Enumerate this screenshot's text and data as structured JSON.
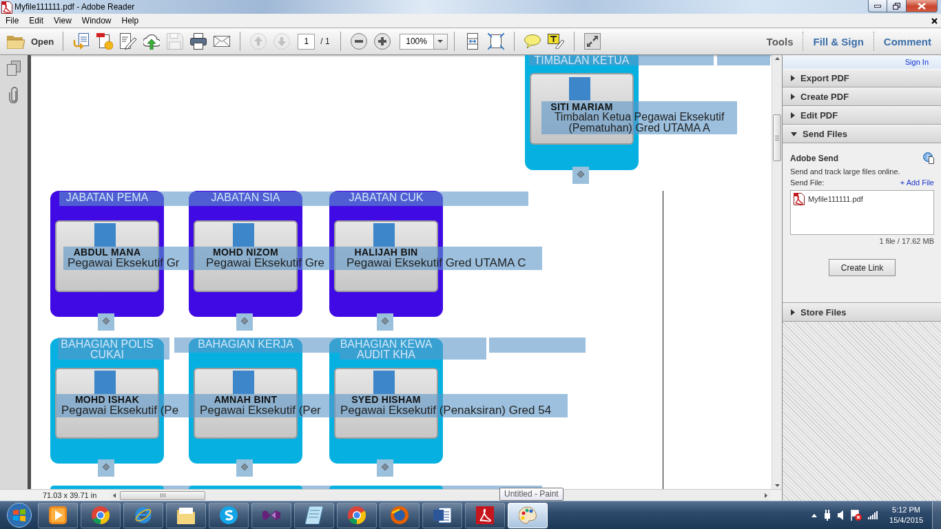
{
  "window": {
    "title": "Myfile111111.pdf - Adobe Reader"
  },
  "menu": [
    "File",
    "Edit",
    "View",
    "Window",
    "Help"
  ],
  "toolbar": {
    "open": "Open",
    "tools": [
      {
        "kind": "convert",
        "disabled": false
      },
      {
        "kind": "combine",
        "disabled": false
      },
      {
        "kind": "edit",
        "disabled": false
      },
      {
        "kind": "upload",
        "disabled": false
      },
      {
        "kind": "save",
        "disabled": true
      },
      {
        "kind": "print",
        "disabled": false
      },
      {
        "kind": "email",
        "disabled": false
      }
    ],
    "page_nav": [
      {
        "kind": "prev",
        "disabled": true
      },
      {
        "kind": "next",
        "disabled": true
      }
    ],
    "page_field": {
      "value": "1"
    },
    "page_total": "/ 1",
    "zoom_field": {
      "value": "100%"
    },
    "tasks": [
      {
        "label": "Tools",
        "selected": true
      },
      {
        "label": "Fill & Sign",
        "selected": false
      },
      {
        "label": "Comment",
        "selected": false
      }
    ]
  },
  "org_chart": {
    "text_selected": true,
    "levels": [
      [
        {
          "color": "#06b1e1",
          "header": [
            "TIMBALAN KETUA"
          ],
          "name": "SITI MARIAM",
          "title": [
            "Timbalan Ketua Pegawai Eksekutif",
            "(Pematuhan) Gred UTAMA A"
          ]
        }
      ],
      [
        {
          "color": "#400ae4",
          "header": [
            "JABATAN PEMA"
          ],
          "name": "ABDUL MANA",
          "title": [
            "Pegawai Eksekutif Gr"
          ]
        },
        {
          "color": "#400ae4",
          "header": [
            "JABATAN SIA"
          ],
          "name": "MOHD NIZOM",
          "title": [
            "Pegawai Eksekutif Gre"
          ]
        },
        {
          "color": "#400ae4",
          "header": [
            "JABATAN CUK"
          ],
          "name": "HALIJAH BIN",
          "title": [
            "Pegawai Eksekutif Gred UTAMA C"
          ]
        }
      ],
      [
        {
          "color": "#06b1e1",
          "header": [
            "BAHAGIAN POLIS",
            "CUKAI"
          ],
          "name": "MOHD ISHAK",
          "title": [
            "Pegawai Eksekutif (Pe"
          ]
        },
        {
          "color": "#06b1e1",
          "header": [
            "BAHAGIAN KERJA"
          ],
          "name": "AMNAH BINT",
          "title": [
            "Pegawai Eksekutif (Per"
          ]
        },
        {
          "color": "#06b1e1",
          "header": [
            "BAHAGIAN KEWA",
            "AUDIT KHA"
          ],
          "name": "SYED HISHAM",
          "title": [
            "Pegawai Eksekutif (Penaksiran) Gred 54"
          ]
        }
      ],
      [
        {
          "color": "#06b1e1"
        },
        {
          "color": "#06b1e1"
        },
        {
          "color": "#06b1e1"
        }
      ]
    ]
  },
  "status_bar": {
    "page_size": "71.03 x 39.71 in"
  },
  "tools_pane": {
    "sign_in": "Sign In",
    "sections": [
      {
        "label": "Export PDF",
        "expanded": false
      },
      {
        "label": "Create PDF",
        "expanded": false
      },
      {
        "label": "Edit PDF",
        "expanded": false
      },
      {
        "label": "Send Files",
        "expanded": true,
        "content": {
          "heading": "Adobe Send",
          "description": "Send and track large files online.",
          "send_file_label": "Send File:",
          "add_file": "+ Add File",
          "files": [
            "Myfile111111.pdf"
          ],
          "summary": "1 file / 17.62 MB",
          "create_link": "Create Link"
        }
      },
      {
        "label": "Store Files",
        "expanded": false
      }
    ]
  },
  "tooltip": "Untitled - Paint",
  "taskbar": {
    "apps": [
      {
        "kind": "media",
        "hovered": false
      },
      {
        "kind": "chrome",
        "hovered": false
      },
      {
        "kind": "ie",
        "hovered": false
      },
      {
        "kind": "explorer",
        "hovered": false
      },
      {
        "kind": "skype",
        "hovered": false
      },
      {
        "kind": "studio",
        "hovered": false
      },
      {
        "kind": "journal",
        "hovered": false
      },
      {
        "kind": "chrome",
        "hovered": false
      },
      {
        "kind": "firefox",
        "hovered": false
      },
      {
        "kind": "word",
        "hovered": false
      },
      {
        "kind": "reader",
        "hovered": false
      },
      {
        "kind": "paint",
        "hovered": true
      }
    ],
    "time": "5:12 PM",
    "date": "15/4/2015"
  }
}
